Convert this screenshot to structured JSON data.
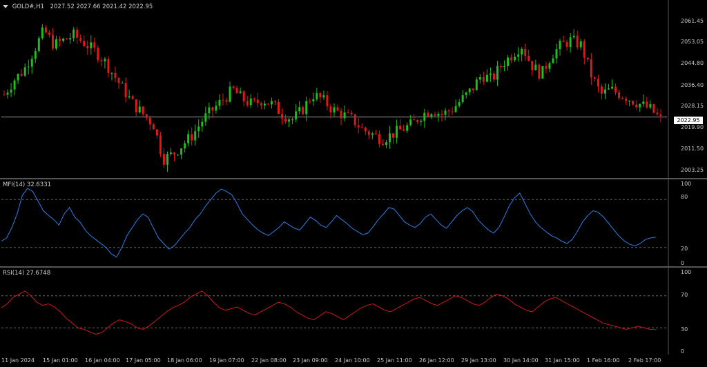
{
  "main": {
    "symbol": "GOLD#,H1",
    "ohlc": "2027.52 2027.66 2021.42 2022.95",
    "current_price": "2022.95",
    "price_labels": [
      "2061.45",
      "2053.05",
      "2044.80",
      "2036.40",
      "2028.15",
      "2019.90",
      "2011.50",
      "2003.25"
    ]
  },
  "mfi": {
    "title": "MFI(14) 32.6331",
    "levels": [
      "100",
      "80",
      "20",
      "0"
    ]
  },
  "rsi": {
    "title": "RSI(14) 27.6748",
    "levels": [
      "100",
      "70",
      "30",
      "0"
    ]
  },
  "time_axis": [
    "11 Jan 2024",
    "15 Jan 01:00",
    "16 Jan 04:00",
    "17 Jan 05:00",
    "18 Jan 06:00",
    "19 Jan 07:00",
    "22 Jan 08:00",
    "23 Jan 09:00",
    "24 Jan 10:00",
    "25 Jan 11:00",
    "26 Jan 12:00",
    "29 Jan 13:00",
    "30 Jan 14:00",
    "31 Jan 15:00",
    "1 Feb 16:00",
    "2 Feb 17:00"
  ],
  "colors": {
    "bull": "#1fbe1f",
    "bear": "#e01818",
    "mfi": "#2f7fe8",
    "rsi": "#d01818",
    "grid": "#777777"
  },
  "chart_data": [
    {
      "type": "candlestick",
      "title": "GOLD#,H1",
      "ylim": [
        2000,
        2068
      ],
      "current": 2022.95,
      "price_path": [
        2032,
        2038,
        2042,
        2050,
        2058,
        2052,
        2054,
        2056,
        2053,
        2050,
        2046,
        2040,
        2034,
        2028,
        2024,
        2020,
        2006,
        2008,
        2012,
        2016,
        2022,
        2026,
        2030,
        2034,
        2030,
        2028,
        2030,
        2028,
        2024,
        2022,
        2026,
        2032,
        2030,
        2026,
        2024,
        2022,
        2018,
        2016,
        2014,
        2016,
        2018,
        2020,
        2024,
        2026,
        2024,
        2026,
        2030,
        2034,
        2040,
        2038,
        2044,
        2048,
        2052,
        2044,
        2040,
        2048,
        2052,
        2054,
        2052,
        2040,
        2032,
        2034,
        2032,
        2030,
        2028,
        2026,
        2022
      ],
      "candle_count": 190
    },
    {
      "type": "line",
      "series": [
        {
          "name": "MFI(14)",
          "values": [
            28,
            32,
            45,
            62,
            85,
            94,
            90,
            78,
            66,
            60,
            55,
            48,
            62,
            70,
            58,
            52,
            42,
            35,
            30,
            25,
            20,
            12,
            8,
            20,
            35,
            45,
            55,
            62,
            58,
            45,
            32,
            25,
            18,
            22,
            30,
            38,
            45,
            55,
            62,
            72,
            80,
            88,
            93,
            90,
            86,
            75,
            62,
            55,
            48,
            42,
            38,
            35,
            40,
            45,
            52,
            48,
            44,
            42,
            50,
            58,
            54,
            48,
            45,
            52,
            60,
            55,
            50,
            44,
            40,
            36,
            38,
            46,
            55,
            62,
            70,
            68,
            60,
            52,
            48,
            45,
            50,
            58,
            62,
            55,
            48,
            44,
            52,
            60,
            66,
            70,
            65,
            55,
            48,
            42,
            38,
            45,
            58,
            72,
            82,
            88,
            75,
            62,
            52,
            45,
            40,
            35,
            32,
            28,
            25,
            30,
            40,
            52,
            60,
            66,
            64,
            58,
            50,
            42,
            34,
            28,
            24,
            22,
            25,
            30,
            32,
            33
          ]
        }
      ],
      "ylim": [
        0,
        100
      ],
      "levels": [
        80,
        20
      ]
    },
    {
      "type": "line",
      "series": [
        {
          "name": "RSI(14)",
          "values": [
            55,
            60,
            68,
            72,
            76,
            70,
            62,
            58,
            60,
            56,
            50,
            42,
            36,
            30,
            28,
            25,
            22,
            24,
            30,
            36,
            40,
            38,
            35,
            30,
            28,
            32,
            38,
            44,
            50,
            55,
            58,
            62,
            68,
            72,
            76,
            70,
            62,
            55,
            52,
            54,
            56,
            52,
            48,
            46,
            50,
            54,
            58,
            62,
            60,
            56,
            50,
            46,
            42,
            40,
            45,
            50,
            48,
            44,
            40,
            45,
            50,
            55,
            58,
            60,
            56,
            52,
            50,
            54,
            58,
            62,
            66,
            68,
            64,
            60,
            58,
            62,
            66,
            70,
            68,
            64,
            60,
            58,
            62,
            68,
            72,
            70,
            66,
            60,
            56,
            52,
            50,
            56,
            62,
            66,
            68,
            64,
            60,
            56,
            52,
            48,
            44,
            40,
            36,
            34,
            32,
            30,
            28,
            30,
            32,
            30,
            28,
            27.67
          ]
        }
      ],
      "ylim": [
        0,
        100
      ],
      "levels": [
        70,
        30
      ]
    }
  ]
}
